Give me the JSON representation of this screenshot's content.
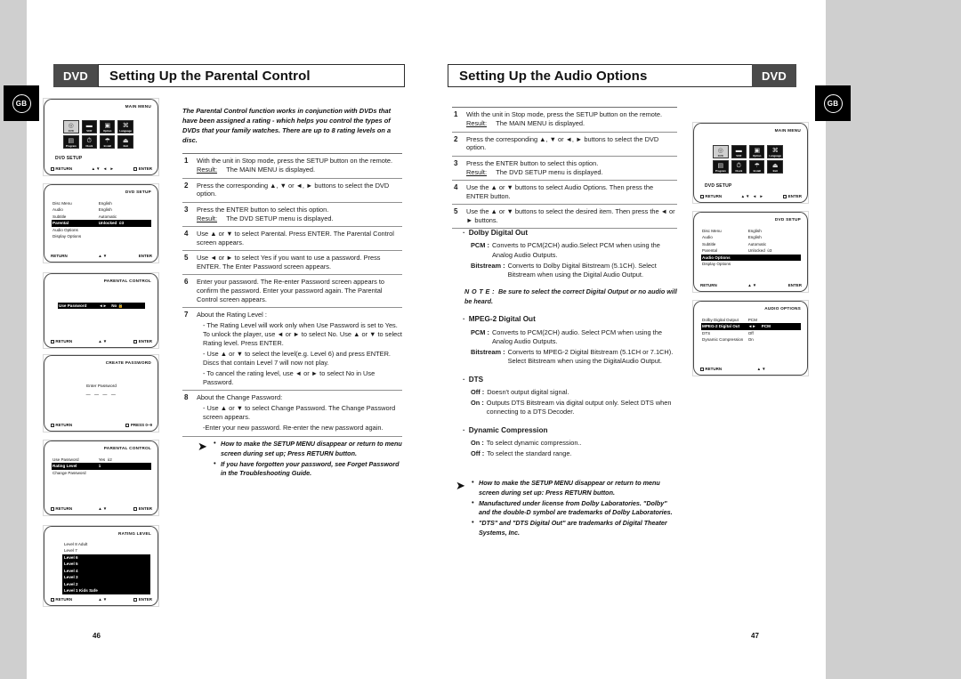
{
  "document": {
    "left_page_number": "46",
    "right_page_number": "47",
    "region_badge": "GB"
  },
  "left_page": {
    "header": {
      "tag": "DVD",
      "title": "Setting Up the Parental Control"
    },
    "intro": "The Parental Control function works in conjunction with DVDs that have been assigned a rating - which helps you control the types of DVDs that your family watches. There are up to 8 rating levels on a disc.",
    "steps": [
      {
        "num": "1",
        "text": "With the unit in Stop mode, press the SETUP button on the remote.",
        "result_label": "Result:",
        "result": "The MAIN MENU is displayed."
      },
      {
        "num": "2",
        "text": "Press the corresponding ▲, ▼ or ◄, ► buttons to select the DVD option."
      },
      {
        "num": "3",
        "text": "Press the ENTER button to select this option.",
        "result_label": "Result:",
        "result": "The DVD SETUP  menu is displayed."
      },
      {
        "num": "4",
        "text": "Use ▲ or ▼ to select Parental. Press ENTER. The Parental Control screen appears."
      },
      {
        "num": "5",
        "text": "Use ◄ or ► to select Yes if you want to use a password. Press ENTER. The Enter Password screen appears."
      },
      {
        "num": "6",
        "text": "Enter your password. The Re-enter Password screen appears to confirm the password. Enter your password again. The Parental Control screen appears."
      },
      {
        "num": "7",
        "text": "About the Rating Level :",
        "sub": [
          "- The Rating Level will work only when Use Password is set to Yes. To unlock the player, use ◄ or ► to select No. Use ▲ or ▼ to select Rating level. Press ENTER.",
          "- Use ▲ or ▼ to select the level(e.g. Level 6) and press ENTER. Discs that contain Level 7 will now not play.",
          "- To cancel the rating level, use ◄ or ► to select No in Use Password."
        ]
      },
      {
        "num": "8",
        "text": "About the Change Password:",
        "sub": [
          "- Use ▲ or ▼ to select Change Password. The Change Password screen appears.",
          "-Enter your new password. Re-enter the new password again."
        ]
      }
    ],
    "tips": [
      "How to make the SETUP MENU disappear or return to menu screen during set up; Press RETURN button.",
      "If you have forgotten your password, see Forget Password in the Troubleshooting Guide."
    ],
    "screens": [
      {
        "type": "main-menu",
        "title": "MAIN MENU",
        "items": [
          "DVD",
          "VCR",
          "Option",
          "Language",
          "Program",
          "Clock",
          "Install",
          "Exit"
        ],
        "setup_label": "DVD SETUP",
        "footer_left": "RETURN",
        "footer_mid": "▲▼ ◄ ►",
        "footer_right": "ENTER"
      },
      {
        "type": "list",
        "title": "DVD SETUP",
        "rows": [
          {
            "label": "Disc Menu",
            "value": "English",
            "selected": false
          },
          {
            "label": "Audio",
            "value": "English",
            "selected": false
          },
          {
            "label": "Subtitle",
            "value": "Automatic",
            "selected": false
          },
          {
            "label": "Parental",
            "value": "Unlocked  ὑ3",
            "selected": true
          },
          {
            "label": "Audio Options",
            "value": "",
            "selected": false
          },
          {
            "label": "Display Options",
            "value": "",
            "selected": false
          }
        ],
        "footer_left": "RETURN",
        "footer_mid": "▲▼",
        "footer_right": "ENTER",
        "footer_plain": true
      },
      {
        "type": "single-row",
        "title": "PARENTAL CONTROL",
        "row": {
          "label": "Use Password",
          "arrows": "◄►",
          "value": "No"
        },
        "footer_left": "RETURN",
        "footer_mid": "▲▼",
        "footer_right": "ENTER"
      },
      {
        "type": "password",
        "title": "CREATE PASSWORD",
        "prompt": "Enter Password",
        "dashes": "— — — —",
        "footer_left": "RETURN",
        "footer_right": "PRESS 0~9"
      },
      {
        "type": "list",
        "title": "PARENTAL CONTROL",
        "rows": [
          {
            "label": "Use Password",
            "value": "Yes  ὑ2",
            "selected": false
          },
          {
            "label": "Rating Level",
            "value": "1",
            "selected": true
          },
          {
            "label": "Change Password",
            "value": "",
            "selected": false
          }
        ],
        "footer_left": "RETURN",
        "footer_mid": "▲▼",
        "footer_right": "ENTER"
      },
      {
        "type": "rating",
        "title": "RATING LEVEL",
        "levels": [
          {
            "label": "Level 8 Adult",
            "on": false
          },
          {
            "label": "Level 7",
            "on": false
          },
          {
            "label": "Level 6",
            "on": true
          },
          {
            "label": "Level 5",
            "on": true
          },
          {
            "label": "Level 4",
            "on": true
          },
          {
            "label": "Level 3",
            "on": true
          },
          {
            "label": "Level 2",
            "on": true
          },
          {
            "label": "Level 1  Kids Safe",
            "on": true
          }
        ],
        "footer_left": "RETURN",
        "footer_mid": "▲▼",
        "footer_right": "ENTER"
      }
    ]
  },
  "right_page": {
    "header": {
      "tag": "DVD",
      "title": "Setting Up the Audio Options"
    },
    "steps": [
      {
        "num": "1",
        "text": "With the unit in Stop mode, press the SETUP button on the remote.",
        "result_label": "Result:",
        "result": "The MAIN MENU is displayed."
      },
      {
        "num": "2",
        "text": "Press the corresponding ▲, ▼ or ◄, ► buttons to select the DVD option."
      },
      {
        "num": "3",
        "text": "Press the ENTER button to select this option.",
        "result_label": "Result:",
        "result": "The DVD SETUP  menu is displayed."
      },
      {
        "num": "4",
        "text": "Use the ▲ or ▼ buttons to select Audio Options. Then press the ENTER button."
      },
      {
        "num": "5",
        "text": "Use the ▲ or ▼ buttons to select the desired item. Then press the ◄ or ► buttons."
      }
    ],
    "sections": [
      {
        "heading": "Dolby Digital Out",
        "defs": [
          {
            "key": "PCM :",
            "value": "Converts to PCM(2CH) audio.Select PCM when using the Analog Audio Outputs."
          },
          {
            "key": "Bitstream :",
            "value": "Converts to Dolby Digital Bitstream (5.1CH). Select Bitstream when using the Digital Audio Output."
          }
        ],
        "note_label": "N O T E :",
        "note": "Be sure to select the correct Digital Output or no audio will be heard."
      },
      {
        "heading": "MPEG-2 Digital Out",
        "defs": [
          {
            "key": "PCM :",
            "value": "Converts to PCM(2CH) audio. Select PCM when using the Analog Audio Outputs."
          },
          {
            "key": "Bitstream :",
            "value": "Converts to MPEG-2 Digital Bitstream (5.1CH or 7.1CH). Select Bitstream when using the DigitalAudio Output."
          }
        ]
      },
      {
        "heading": "DTS",
        "defs": [
          {
            "key": "Off :",
            "value": "Doesn't output digital signal."
          },
          {
            "key": "On :",
            "value": "Outputs DTS Bitstream via digital output only. Select DTS when connecting to a DTS Decoder."
          }
        ]
      },
      {
        "heading": "Dynamic Compression",
        "defs": [
          {
            "key": "On :",
            "value": "To select dynamic compression.."
          },
          {
            "key": "Off :",
            "value": "To select the standard range."
          }
        ]
      }
    ],
    "tips": [
      "How to make the SETUP MENU disappear or return to menu screen during set up: Press RETURN button.",
      "Manufactured under license from Dolby Laboratories. \"Dolby\" and the double-D symbol are trademarks of Dolby Laboratories.",
      "\"DTS\" and \"DTS Digital Out\" are trademarks of Digital Theater Systems, Inc."
    ],
    "screens": [
      {
        "type": "main-menu",
        "title": "MAIN MENU",
        "items": [
          "DVD",
          "VCR",
          "Option",
          "Language",
          "Program",
          "Clock",
          "Install",
          "Exit"
        ],
        "setup_label": "DVD SETUP",
        "footer_left": "RETURN",
        "footer_mid": "▲▼ ◄ ►",
        "footer_right": "ENTER"
      },
      {
        "type": "list",
        "title": "DVD SETUP",
        "rows": [
          {
            "label": "Disc Menu",
            "value": "English",
            "selected": false
          },
          {
            "label": "Audio",
            "value": "English",
            "selected": false
          },
          {
            "label": "Subtitle",
            "value": "Automatic",
            "selected": false
          },
          {
            "label": "Parental",
            "value": "Unlocked  ὑ3",
            "selected": false
          },
          {
            "label": "Audio Options",
            "value": "",
            "selected": true
          },
          {
            "label": "Display Options",
            "value": "",
            "selected": false
          }
        ],
        "footer_left": "RETURN",
        "footer_mid": "▲▼",
        "footer_right": "ENTER",
        "footer_plain": true
      },
      {
        "type": "list",
        "title": "AUDIO OPTIONS",
        "rows": [
          {
            "label": "Dolby Digital Output",
            "value": "PCM",
            "selected": false
          },
          {
            "label": "MPEG-2 Digital Out",
            "value": "PCM",
            "arrows": "◄►",
            "selected": true
          },
          {
            "label": "DTS",
            "value": "Off",
            "selected": false
          },
          {
            "label": "Dynamic Compression",
            "value": "On",
            "selected": false
          }
        ],
        "footer_left": "RETURN",
        "footer_mid": "▲▼",
        "footer_right": ""
      }
    ]
  }
}
